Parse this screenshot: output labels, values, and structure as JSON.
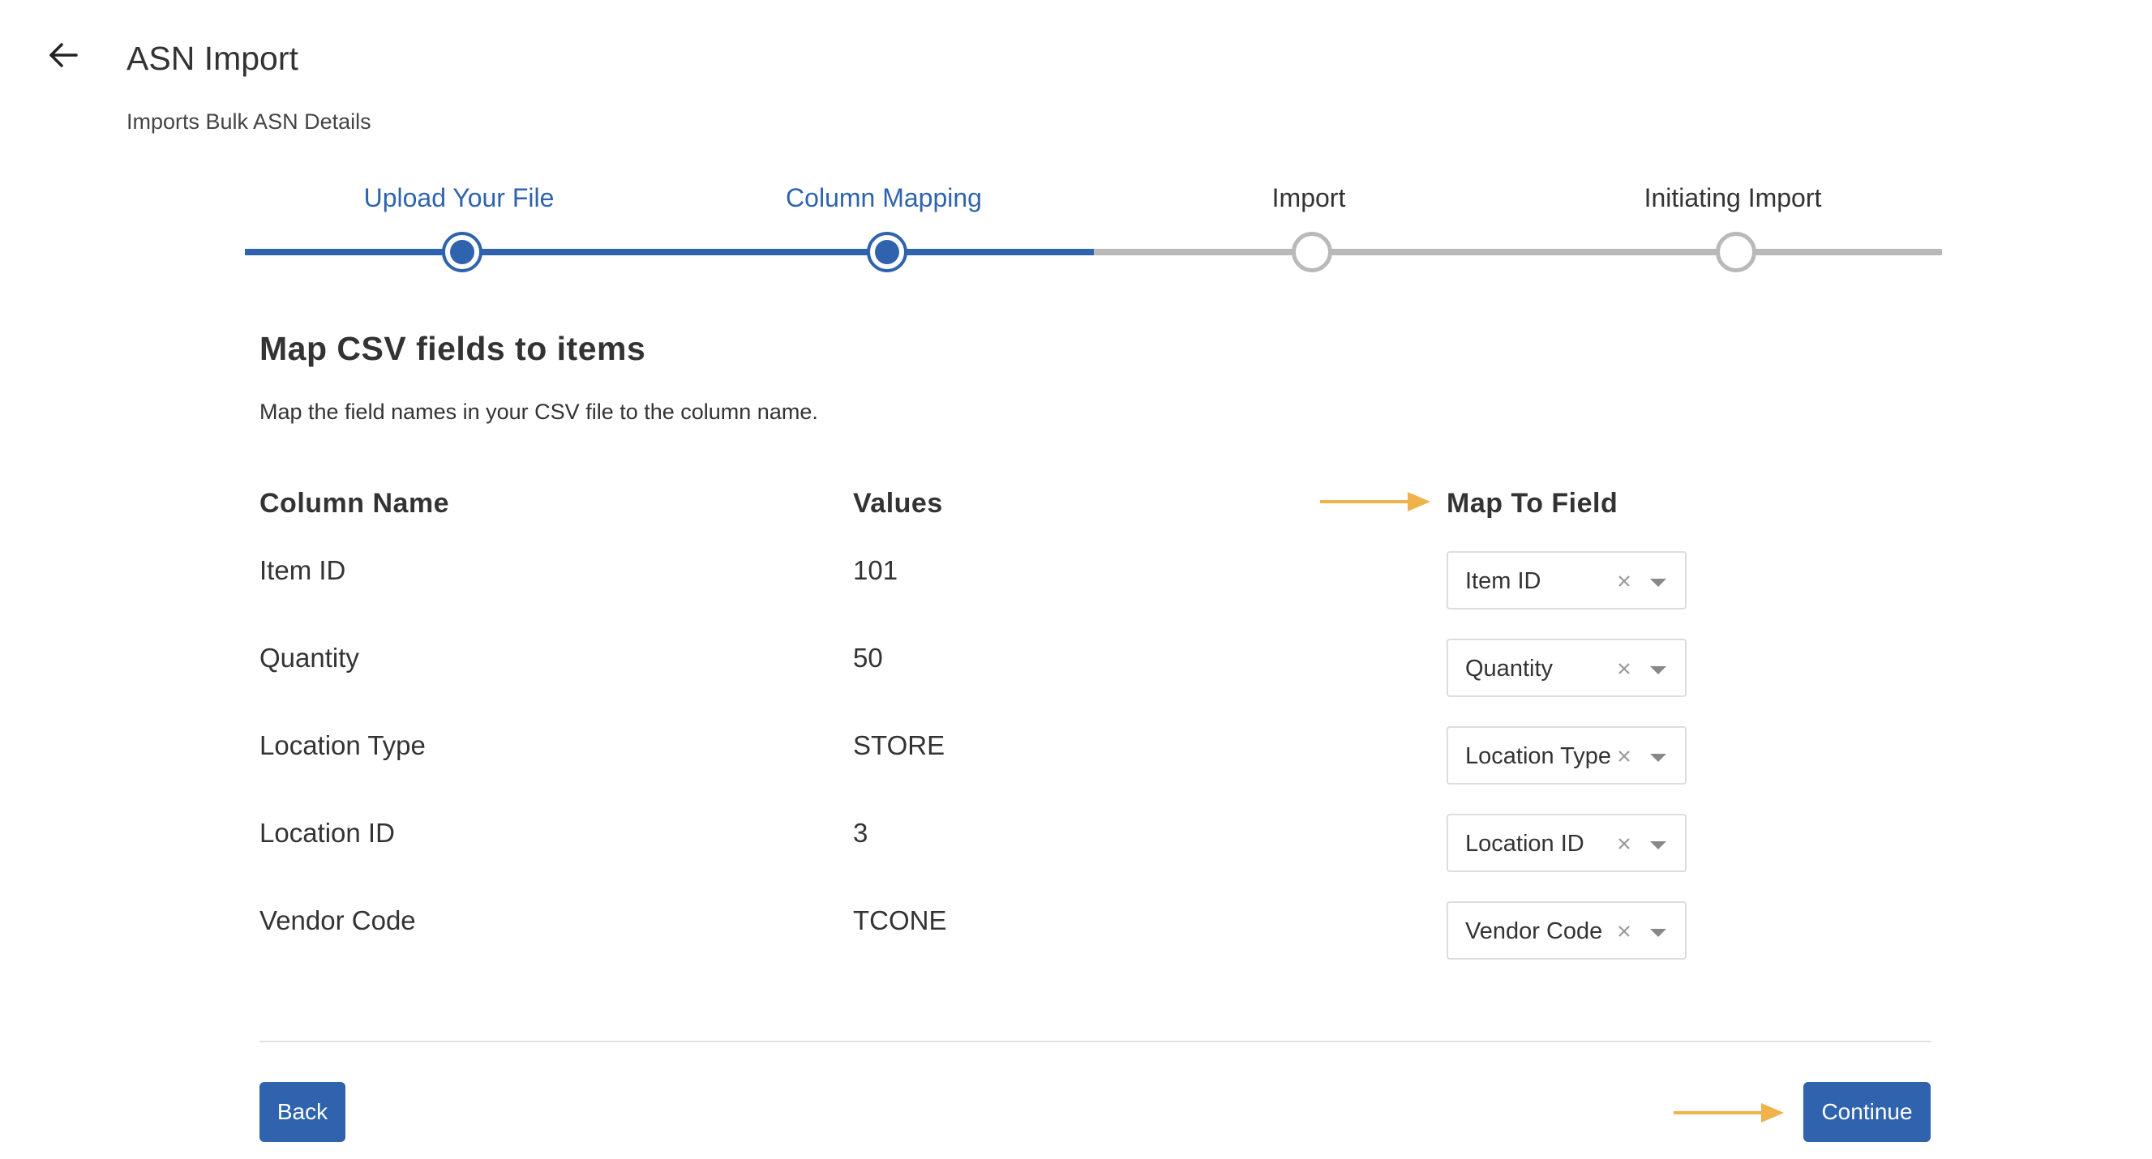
{
  "header": {
    "title": "ASN Import",
    "subtitle": "Imports Bulk ASN Details"
  },
  "stepper": {
    "steps": [
      {
        "label": "Upload Your File",
        "status": "complete"
      },
      {
        "label": "Column Mapping",
        "status": "active"
      },
      {
        "label": "Import",
        "status": "pending"
      },
      {
        "label": "Initiating Import",
        "status": "pending"
      }
    ]
  },
  "mapping": {
    "title": "Map CSV fields to items",
    "description": "Map the field names in your CSV file to the column name.",
    "headers": {
      "column_name": "Column Name",
      "values": "Values",
      "map_to_field": "Map To Field"
    },
    "rows": [
      {
        "column": "Item ID",
        "value": "101",
        "mapped": "Item ID"
      },
      {
        "column": "Quantity",
        "value": "50",
        "mapped": "Quantity"
      },
      {
        "column": "Location Type",
        "value": "STORE",
        "mapped": "Location Type"
      },
      {
        "column": "Location ID",
        "value": "3",
        "mapped": "Location ID"
      },
      {
        "column": "Vendor Code",
        "value": "TCONE",
        "mapped": "Vendor Code"
      }
    ]
  },
  "footer": {
    "back_label": "Back",
    "continue_label": "Continue"
  },
  "colors": {
    "primary": "#2f63ad",
    "inactive": "#b9b9b9",
    "annotation_arrow": "#f0b24a"
  },
  "icons": {
    "back": "arrow-left-icon",
    "clear": "close-icon",
    "dropdown": "chevron-down-icon",
    "annotation": "arrow-right-icon"
  }
}
